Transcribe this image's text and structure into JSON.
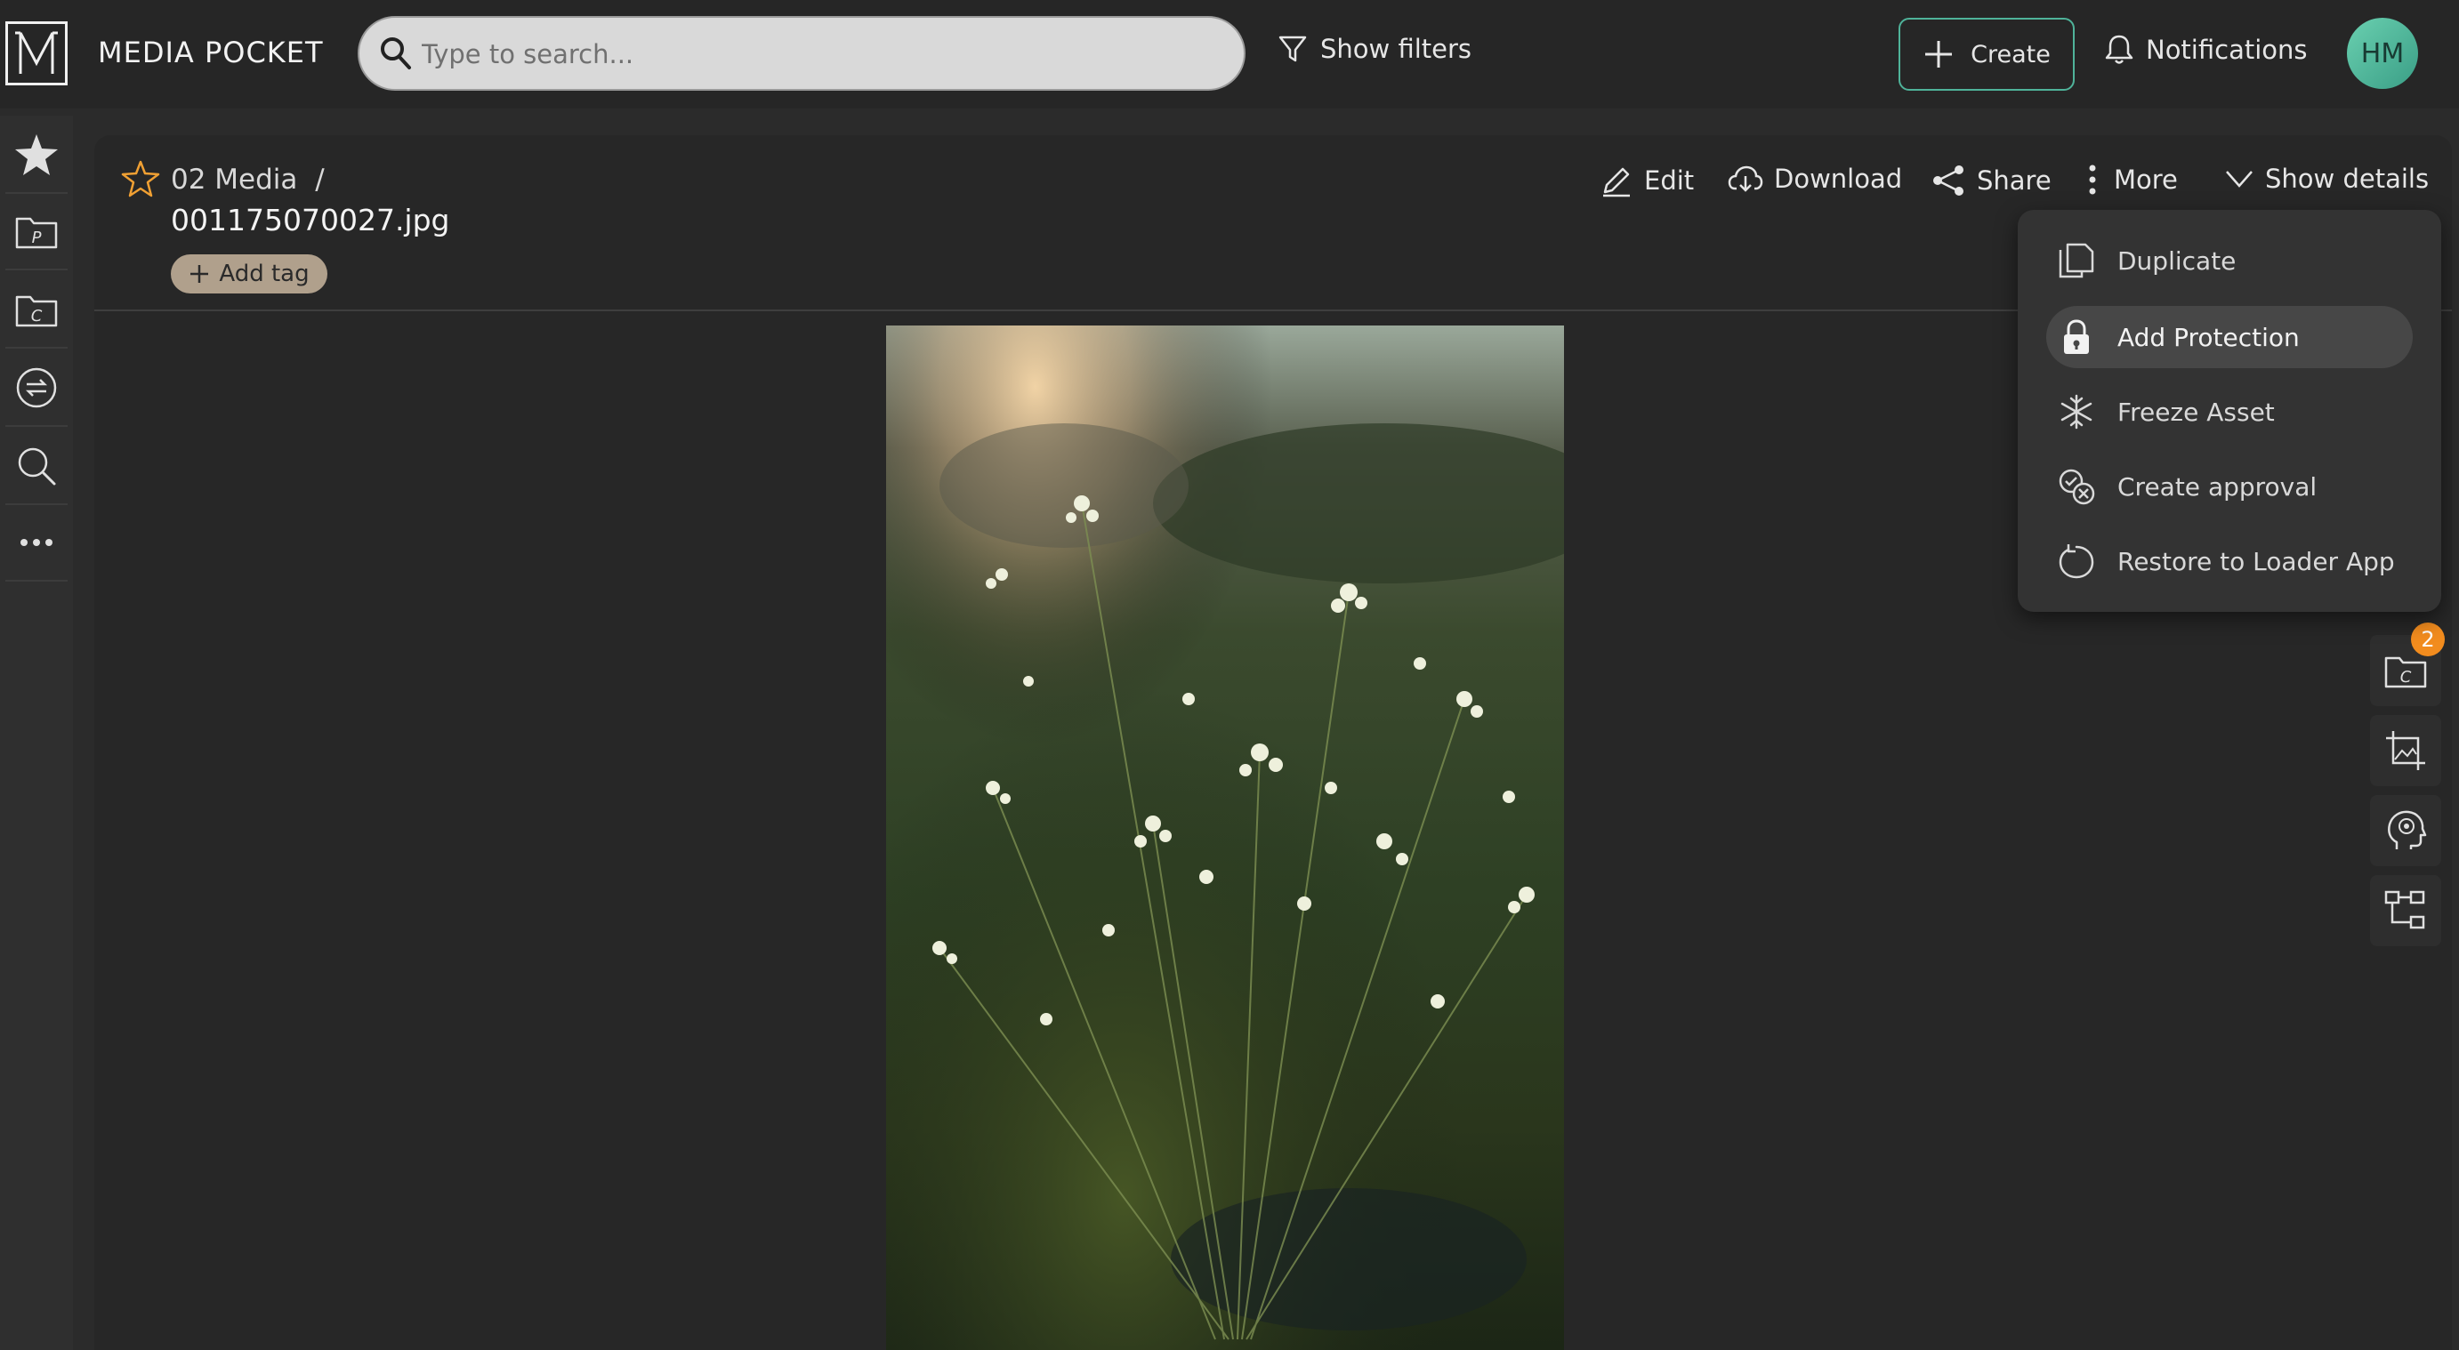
{
  "app": {
    "brand": "MEDIA POCKET",
    "logo_letter": "M"
  },
  "search": {
    "placeholder": "Type to search..."
  },
  "header": {
    "show_filters": "Show filters",
    "create": "Create",
    "notifications": "Notifications",
    "avatar_initials": "HM"
  },
  "asset": {
    "breadcrumb": "02 Media",
    "separator": "/",
    "filename": "001175070027.jpg",
    "add_tag": "Add tag"
  },
  "actions": {
    "edit": "Edit",
    "download": "Download",
    "share": "Share",
    "more": "More",
    "show_details": "Show details"
  },
  "more_menu": {
    "items": [
      {
        "label": "Duplicate",
        "icon": "duplicate-icon"
      },
      {
        "label": "Add Protection",
        "icon": "lock-icon",
        "highlighted": true
      },
      {
        "label": "Freeze Asset",
        "icon": "snowflake-icon"
      },
      {
        "label": "Create approval",
        "icon": "approval-icon"
      },
      {
        "label": "Restore to Loader App",
        "icon": "restore-icon"
      }
    ]
  },
  "right_tools": {
    "collections_badge": "2"
  },
  "colors": {
    "accent": "#4fb39a",
    "badge": "#f28c1e",
    "favorite_star": "#f0a033",
    "tag_background": "#b0a08c"
  }
}
